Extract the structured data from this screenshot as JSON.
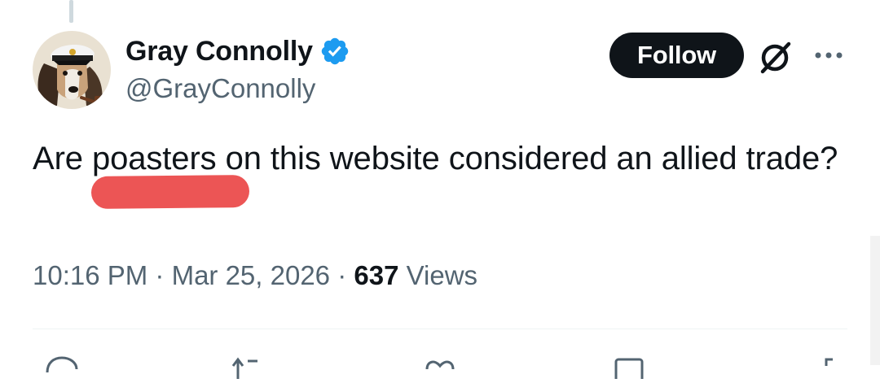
{
  "author": {
    "display_name": "Gray Connolly",
    "handle": "@GrayConnolly",
    "verified": true,
    "avatar_icon": "basset-hound-captain-avatar"
  },
  "follow_button": {
    "label": "Follow"
  },
  "tweet": {
    "text": "Are poasters on this website considered an allied trade?",
    "redacted_overlay": true
  },
  "meta": {
    "time": "10:16 PM",
    "separator": " · ",
    "date": "Mar 25, 2026",
    "views_count": "637",
    "views_label": " Views"
  },
  "actions": [
    "reply-icon",
    "retweet-icon",
    "like-icon",
    "bookmark-icon",
    "share-icon"
  ],
  "colors": {
    "text_primary": "#0f1419",
    "text_secondary": "#536471",
    "verified_blue": "#1d9bf0",
    "follow_bg": "#0f1419",
    "redaction": "#ec5555"
  }
}
